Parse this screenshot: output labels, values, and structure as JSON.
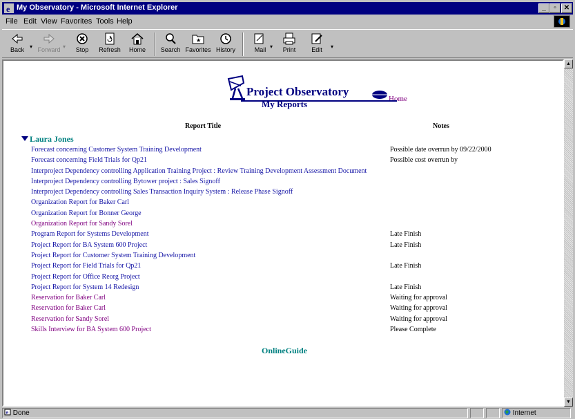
{
  "window": {
    "title": "My Observatory - Microsoft Internet Explorer",
    "controls": {
      "minimize": "_",
      "maximize": "▫",
      "close": "✕"
    }
  },
  "menu": [
    "File",
    "Edit",
    "View",
    "Favorites",
    "Tools",
    "Help"
  ],
  "toolbar": [
    {
      "label": "Back",
      "icon": "back-arrow-icon"
    },
    {
      "label": "Forward",
      "icon": "forward-arrow-icon",
      "disabled": true
    },
    {
      "label": "Stop",
      "icon": "stop-icon"
    },
    {
      "label": "Refresh",
      "icon": "refresh-icon"
    },
    {
      "label": "Home",
      "icon": "home-icon"
    },
    {
      "label": "Search",
      "icon": "search-icon"
    },
    {
      "label": "Favorites",
      "icon": "favorites-icon"
    },
    {
      "label": "History",
      "icon": "history-icon"
    },
    {
      "label": "Mail",
      "icon": "mail-icon"
    },
    {
      "label": "Print",
      "icon": "print-icon"
    },
    {
      "label": "Edit",
      "icon": "edit-icon"
    }
  ],
  "page": {
    "logo_title": "Project Observatory",
    "home_link": "Home",
    "heading": "My Reports",
    "col_title": "Report Title",
    "col_notes": "Notes",
    "person": "Laura Jones",
    "reports": [
      {
        "title": "Forecast concerning Customer System Training Development",
        "notes": "Possible date overrun by 09/22/2000",
        "visited": false
      },
      {
        "title": "Forecast concerning Field Trials for Qp21",
        "notes": "Possible cost overrun by",
        "visited": false
      },
      {
        "title": "Interproject Dependency controlling Application Training Project : Review Training Development Assessment Document",
        "notes": "",
        "visited": false
      },
      {
        "title": "Interproject Dependency controlling Bytower project : Sales Signoff",
        "notes": "",
        "visited": false
      },
      {
        "title": "Interproject Dependency controlling Sales Transaction Inquiry System : Release Phase Signoff",
        "notes": "",
        "visited": false
      },
      {
        "title": "Organization Report for Baker Carl",
        "notes": "",
        "visited": false
      },
      {
        "title": "Organization Report for Bonner George",
        "notes": "",
        "visited": false
      },
      {
        "title": "Organization Report for Sandy Sorel",
        "notes": "",
        "visited": true
      },
      {
        "title": "Program Report for Systems Development",
        "notes": "Late Finish",
        "visited": false
      },
      {
        "title": "Project Report for BA System 600 Project",
        "notes": "Late Finish",
        "visited": false
      },
      {
        "title": "Project Report for Customer System Training Development",
        "notes": "",
        "visited": false
      },
      {
        "title": "Project Report for Field Trials for Qp21",
        "notes": "Late Finish",
        "visited": false
      },
      {
        "title": "Project Report for Office Reorg Project",
        "notes": "",
        "visited": false
      },
      {
        "title": "Project Report for System 14 Redesign",
        "notes": "Late Finish",
        "visited": false
      },
      {
        "title": "Reservation for Baker Carl",
        "notes": "Waiting for approval",
        "visited": true
      },
      {
        "title": "Reservation for Baker Carl",
        "notes": "Waiting for approval",
        "visited": true
      },
      {
        "title": "Reservation for Sandy Sorel",
        "notes": "Waiting for approval",
        "visited": true
      },
      {
        "title": "Skills Interview for BA System 600 Project",
        "notes": "Please Complete",
        "visited": true
      }
    ],
    "guide_link": "OnlineGuide"
  },
  "status": {
    "text": "Done",
    "zone": "Internet"
  },
  "colors": {
    "link": "#1515a6",
    "visited": "#800080",
    "teal": "#008080",
    "navy": "#000080"
  }
}
